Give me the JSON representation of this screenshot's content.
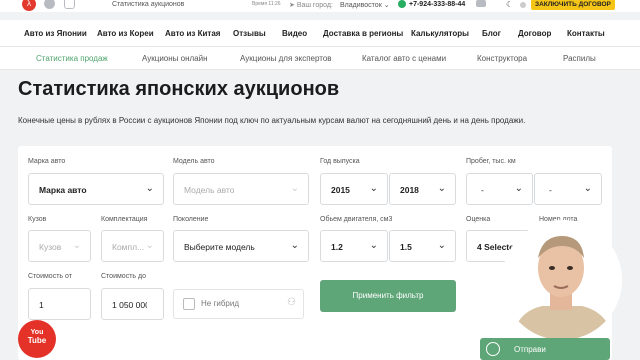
{
  "topbar": {
    "logo_icon": "dragon-logo-icon",
    "breadcrumb": "Статистика аукционов",
    "time": "Время 11:26",
    "location_label": "Ваш город:",
    "city": "Владивосток",
    "phone": "+7-924-333-88-44",
    "cta_label": "ЗАКЛЮЧИТЬ ДОГОВОР"
  },
  "mainnav": {
    "items": [
      "Авто из Японии",
      "Авто из Кореи",
      "Авто из Китая",
      "Отзывы",
      "Видео",
      "Доставка в регионы",
      "Калькуляторы",
      "Блог",
      "Договор",
      "Контакты"
    ]
  },
  "subnav": {
    "items": [
      "Статистика продаж",
      "Аукционы онлайн",
      "Аукционы для экспертов",
      "Каталог авто с ценами",
      "Конструктора",
      "Распилы"
    ],
    "active_index": 0
  },
  "page": {
    "title": "Статистика японских аукционов",
    "description": "Конечные цены в рублях в России с аукционов Японии под ключ по актуальным курсам валют на сегодняшний день и на день продажи."
  },
  "filters": {
    "make_label": "Марка авто",
    "make_value": "Марка авто",
    "model_label": "Модель авто",
    "model_placeholder": "Модель авто",
    "year_label": "Год выпуска",
    "year_from": "2015",
    "year_to": "2018",
    "mileage_label": "Пробег, тыс. км",
    "mileage_from": "-",
    "mileage_to": "-",
    "body_label": "Кузов",
    "body_placeholder": "Кузов",
    "trim_label": "Комплектация",
    "trim_placeholder": "Компл...",
    "generation_label": "Поколение",
    "generation_value": "Выберите модель",
    "engine_label": "Обьем двигателя, см3",
    "engine_from": "1.2",
    "engine_to": "1.5",
    "grade_label": "Оценка",
    "grade_value": "4 Selected",
    "lot_label": "Номер лота",
    "price_from_label": "Стоимость от",
    "price_from": "1",
    "price_to_label": "Стоимость до",
    "price_to": "1 050 000",
    "hybrid_label": "Не гибрид",
    "apply_label": "Применить фильтр"
  },
  "overlay": {
    "youtube_line1": "You",
    "youtube_line2": "Tube",
    "send_label": "Отправи"
  },
  "colors": {
    "accent_green": "#5ea677",
    "brand_red": "#e23b2e",
    "cta_yellow": "#f5c518"
  }
}
